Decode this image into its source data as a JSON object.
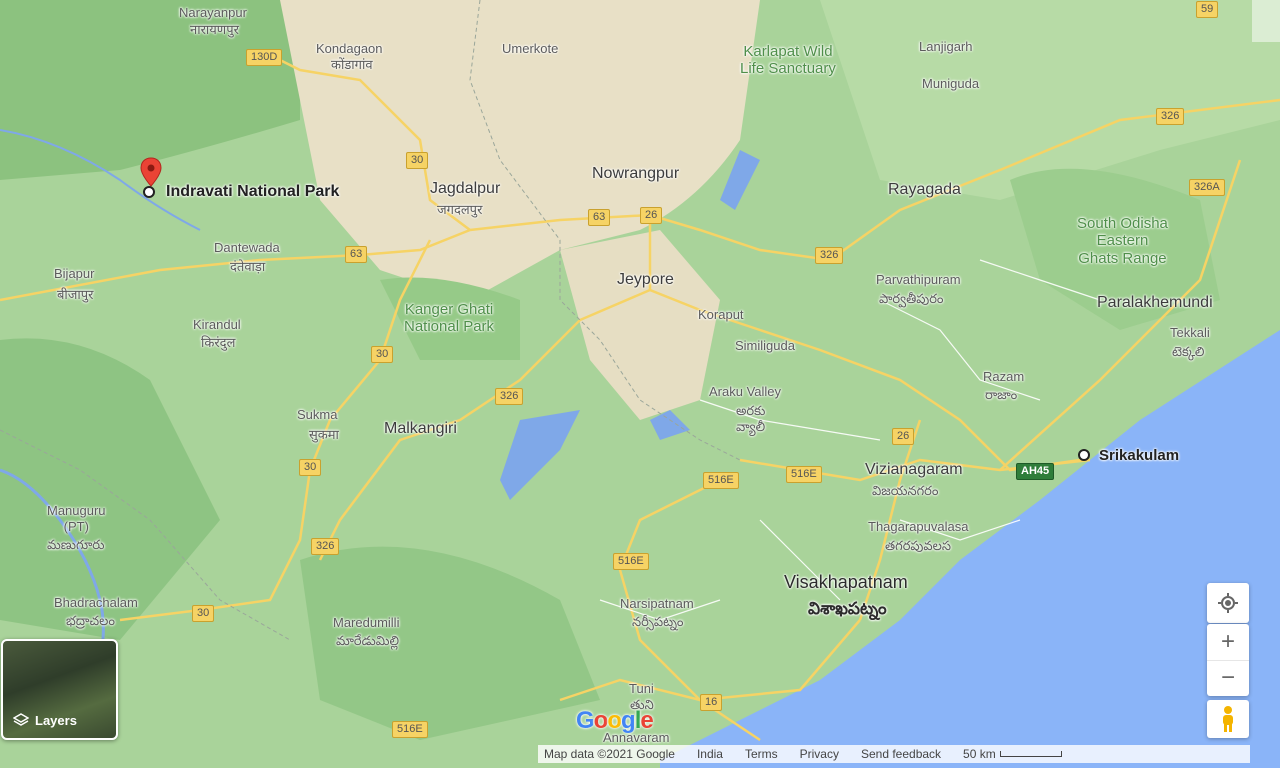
{
  "map": {
    "selected_place": "Indravati National Park",
    "marked_city": "Srikakulam",
    "places": [
      {
        "name": "Narayanpur",
        "local": "नारायणपुर"
      },
      {
        "name": "Kondagaon",
        "local": "कोंडागांव"
      },
      {
        "name": "Umerkote"
      },
      {
        "name": "Karlapat Wild\nLife Sanctuary"
      },
      {
        "name": "Lanjigarh"
      },
      {
        "name": "Muniguda"
      },
      {
        "name": "Jagdalpur",
        "local": "जगदलपुर"
      },
      {
        "name": "Nowrangpur"
      },
      {
        "name": "Rayagada"
      },
      {
        "name": "South Odisha\nEastern\nGhats Range"
      },
      {
        "name": "Dantewada",
        "local": "दंतेवाड़ा"
      },
      {
        "name": "Jeypore"
      },
      {
        "name": "Bijapur",
        "local": "बीजापुर"
      },
      {
        "name": "Parvathipuram",
        "local": "పార్వతీపురం"
      },
      {
        "name": "Paralakhemundi"
      },
      {
        "name": "Kanger Ghati\nNational Park"
      },
      {
        "name": "Koraput"
      },
      {
        "name": "Kirandul",
        "local": "किरंदुल"
      },
      {
        "name": "Similiguda"
      },
      {
        "name": "Tekkali",
        "local": "టెక్కలి"
      },
      {
        "name": "Araku Valley",
        "local": "అరకు\nవ్యాలీ"
      },
      {
        "name": "Razam",
        "local": "రాజాం"
      },
      {
        "name": "Sukma",
        "local": "सुकमा"
      },
      {
        "name": "Malkangiri"
      },
      {
        "name": "Vizianagaram",
        "local": "విజయనగరం"
      },
      {
        "name": "Manuguru\n(PT)",
        "local": "మణుగూరు"
      },
      {
        "name": "Thagarapuvalasa",
        "local": "తగరపువలస"
      },
      {
        "name": "Visakhapatnam",
        "local": "విశాఖపట్నం"
      },
      {
        "name": "Bhadrachalam",
        "local": "భద్రాచలం"
      },
      {
        "name": "Narsipatnam",
        "local": "నర్సీపట్నం"
      },
      {
        "name": "Maredumilli",
        "local": "మారేడుమిల్లి"
      },
      {
        "name": "Tuni",
        "local": "తుని"
      },
      {
        "name": "Annavaram"
      }
    ],
    "road_shields": [
      "130D",
      "30",
      "63",
      "26",
      "326",
      "326A",
      "59",
      "30",
      "326",
      "30",
      "516E",
      "516E",
      "26",
      "516E",
      "326",
      "30",
      "16",
      "516E",
      "AH45"
    ]
  },
  "controls": {
    "layers_label": "Layers",
    "zoom_in": "+",
    "zoom_out": "−"
  },
  "footer": {
    "map_data": "Map data ©2021 Google",
    "country": "India",
    "terms": "Terms",
    "privacy": "Privacy",
    "feedback": "Send feedback",
    "scale": "50 km"
  },
  "logo": "Google"
}
